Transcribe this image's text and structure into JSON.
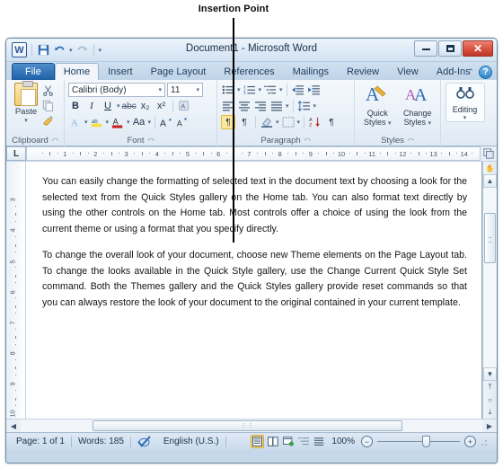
{
  "annotation": {
    "label": "Insertion Point"
  },
  "window": {
    "title": "Document1 - Microsoft Word",
    "logo_text": "W",
    "quick_access": [
      {
        "name": "save-icon",
        "glyph": "ὋE"
      },
      {
        "name": "undo-icon",
        "glyph": "↶"
      },
      {
        "name": "redo-icon",
        "glyph": "↷"
      },
      {
        "name": "customize-qat-icon",
        "glyph": "▾"
      }
    ],
    "controls": {
      "minimize": "Minimize",
      "maximize": "Maximize",
      "close": "✕"
    }
  },
  "tabs": [
    {
      "label": "File",
      "type": "file"
    },
    {
      "label": "Home",
      "type": "active"
    },
    {
      "label": "Insert",
      "type": "normal"
    },
    {
      "label": "Page Layout",
      "type": "normal"
    },
    {
      "label": "References",
      "type": "normal"
    },
    {
      "label": "Mailings",
      "type": "normal"
    },
    {
      "label": "Review",
      "type": "normal"
    },
    {
      "label": "View",
      "type": "normal"
    },
    {
      "label": "Add-Ins",
      "type": "normal"
    }
  ],
  "tab_right": {
    "minimize_ribbon": "⌃",
    "help": "?"
  },
  "ribbon": {
    "clipboard": {
      "label": "Clipboard",
      "paste_label": "Paste",
      "paste_caret": "▾",
      "cut": "✂",
      "copy": "⧉",
      "format_painter": "✐"
    },
    "font": {
      "label": "Font",
      "font_name": "Calibri (Body)",
      "font_size": "11",
      "caret": "▾",
      "bold": "B",
      "italic": "I",
      "underline": "U",
      "strikethrough": "abc",
      "subscript": "x₂",
      "superscript": "x²",
      "clear_formatting": "✐",
      "text_effects": "A",
      "highlight": "ab",
      "font_color": "A",
      "change_case": "Aa",
      "grow_font": "A▴",
      "shrink_font": "A▾"
    },
    "paragraph": {
      "label": "Paragraph",
      "bullets": "≡",
      "numbering": "≡",
      "multilevel": "≡",
      "decrease_indent": "⇤",
      "increase_indent": "⇥",
      "align_left": "≡",
      "align_center": "≡",
      "align_right": "≡",
      "justify": "≡",
      "line_spacing": "↕",
      "ltr_text": "¶",
      "rtl_text": "¶",
      "shading": "▣",
      "borders": "▦",
      "sort": "A↓",
      "show_marks": "¶"
    },
    "styles": {
      "label": "Styles",
      "quick_styles": "Quick Styles",
      "change_styles": "Change Styles",
      "glyph_quick": "A",
      "glyph_change": "AA",
      "caret": "▾"
    },
    "editing": {
      "label": "Editing",
      "button_label": "Editing",
      "glyph": "♊",
      "caret": "▾"
    }
  },
  "ruler": {
    "tab_selector": "L",
    "h_numbers": [
      "1",
      "2",
      "3",
      "4",
      "5",
      "6",
      "7",
      "8",
      "9",
      "10",
      "11",
      "12",
      "13",
      "14"
    ],
    "v_numbers": [
      "3",
      "4",
      "5",
      "6",
      "7",
      "8",
      "9",
      "10"
    ],
    "right_icon": "⎘"
  },
  "document": {
    "paragraphs": [
      "You can easily change the formatting of selected text in the document text by choosing a look for the selected text from the Quick Styles gallery on the Home tab. You can also format text directly by using the other controls on the Home tab. Most controls offer a choice of using the look from the current theme or using a format that you specify directly.",
      "To change the overall look of your document, choose new Theme elements on the Page Layout tab. To change the looks available in the Quick Style gallery, use the Change Current Quick Style Set command. Both the Themes gallery and the Quick Styles gallery provide reset commands so that you can always restore the look of your document to the original contained in your current template."
    ]
  },
  "scrollbars": {
    "up_arrow": "▲",
    "down_arrow": "▼",
    "left_arrow": "◀",
    "right_arrow": "▶",
    "prev_page": "⤒",
    "select_object": "○",
    "next_page": "⤓",
    "hand_icon": "✋"
  },
  "status_bar": {
    "page": "Page: 1 of 1",
    "words": "Words: 185",
    "proofing_icon": "✔",
    "language": "English (U.S.)",
    "views": [
      {
        "name": "print-layout-view",
        "glyph": "▤",
        "active": true
      },
      {
        "name": "full-screen-reading-view",
        "glyph": "▧",
        "active": false
      },
      {
        "name": "web-layout-view",
        "glyph": "▨",
        "active": false
      },
      {
        "name": "outline-view",
        "glyph": "≡",
        "active": false
      },
      {
        "name": "draft-view",
        "glyph": "≡",
        "active": false
      }
    ],
    "zoom_level": "100%",
    "zoom_out": "−",
    "zoom_in": "+"
  },
  "colors": {
    "accent": "#2a5699",
    "file_tab": "#1f5fa6",
    "close_button": "#d8503f",
    "highlight": "#fde79a"
  }
}
